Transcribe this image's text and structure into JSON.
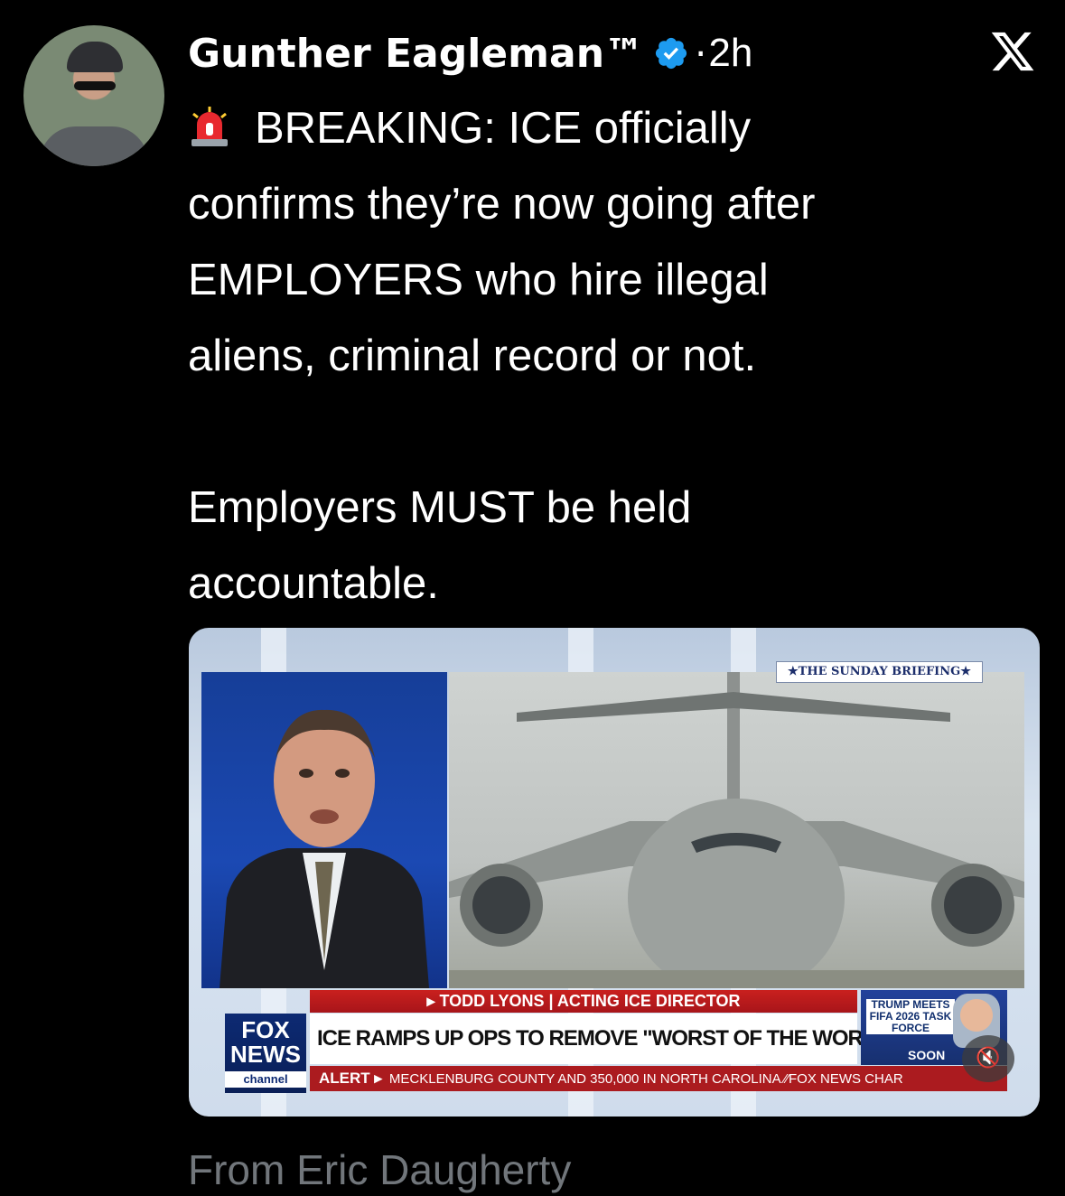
{
  "tweet": {
    "author_name": "Gunther Eagleman™",
    "separator": "·",
    "time": "2h",
    "lines": [
      "BREAKING: ICE officially",
      "confirms they’re now going after",
      "EMPLOYERS who hire illegal",
      "aliens, criminal record or not."
    ],
    "lines2": [
      "Employers MUST be held",
      "accountable."
    ],
    "source_label": "From Eric Daugherty"
  },
  "icons": {
    "siren": "rotating-light-emoji",
    "verified": "verified-badge-icon",
    "x_logo": "x-logo-icon",
    "mute": "speaker-muted-icon"
  },
  "video": {
    "program_tag": "★THE SUNDAY BRIEFING★",
    "name_strap": "▸ TODD LYONS | ACTING ICE DIRECTOR",
    "headline": "ICE RAMPS UP OPS TO REMOVE \"WORST OF THE WORST\"",
    "ticker_alert": "ALERT ▸",
    "ticker_text": "MECKLENBURG COUNTY AND 350,000 IN NORTH CAROLINA   ⁄⁄FOX NEWS  CHAR",
    "network_l1": "FOX",
    "network_l2": "NEWS",
    "network_l3": "channel",
    "promo_text": "TRUMP MEETS FIFA 2026 TASK FORCE",
    "promo_soon": "SOON"
  },
  "colors": {
    "background": "#000000",
    "text": "#ffffff",
    "secondary_text": "#71767b",
    "verified": "#1d9bf0",
    "fox_red": "#ab1b1f",
    "fox_blue": "#0d2a73"
  }
}
